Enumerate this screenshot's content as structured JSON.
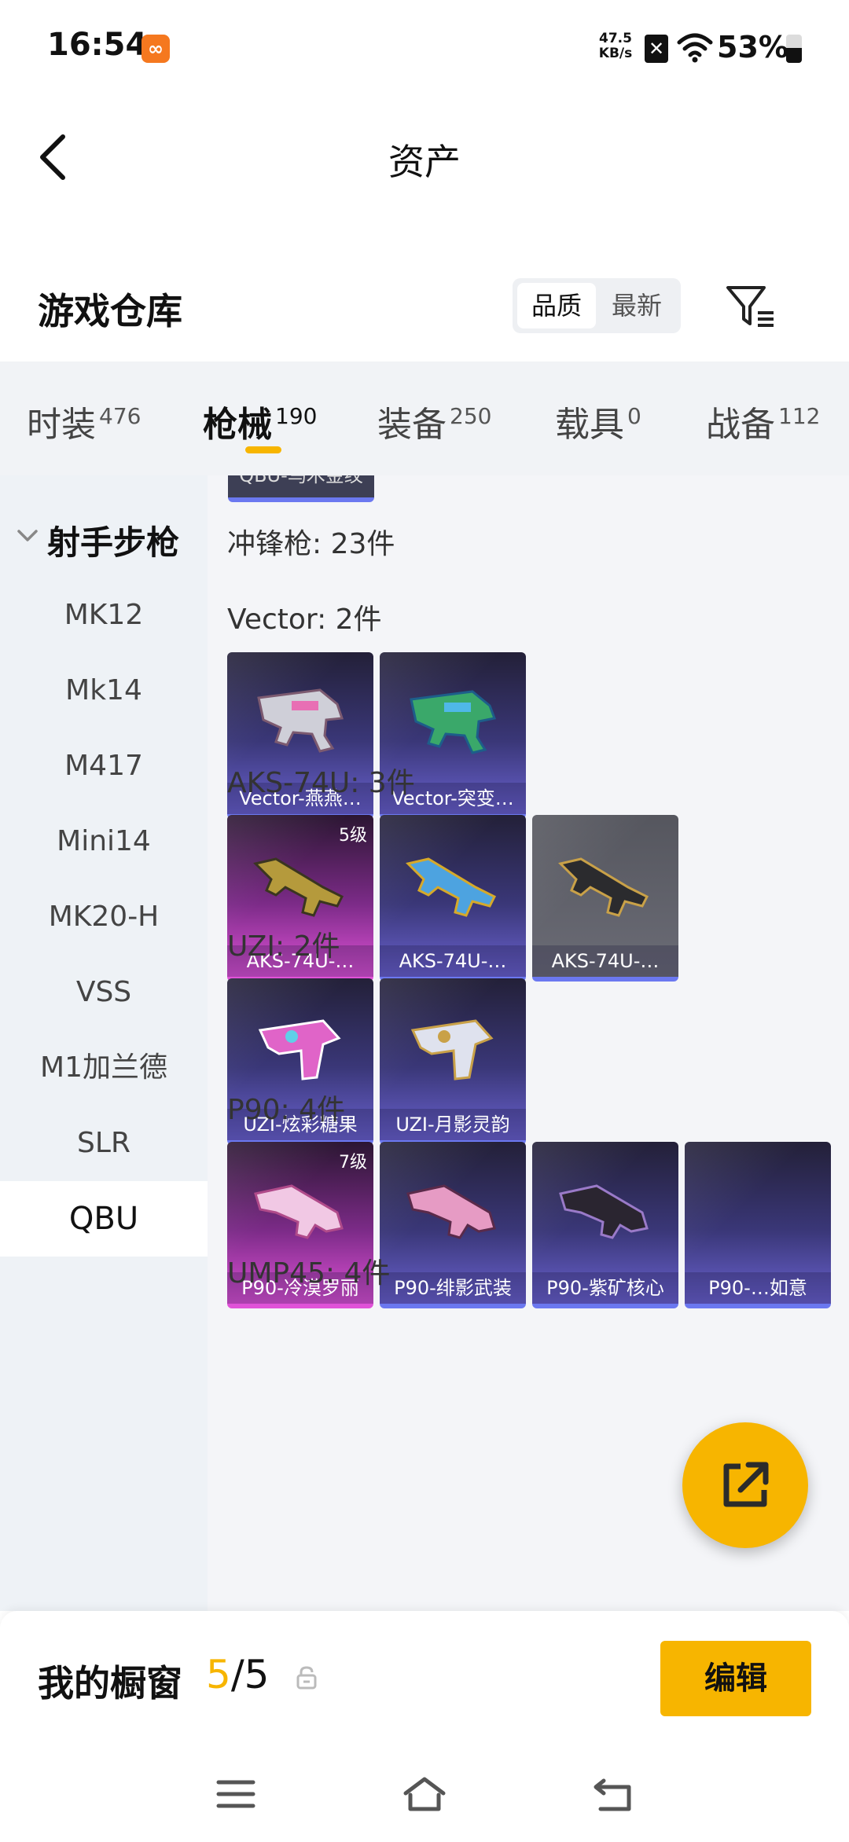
{
  "status_bar": {
    "time": "16:54",
    "app_icon": "orange-app-icon",
    "net_speed_value": "47.5",
    "net_speed_unit": "KB/s",
    "battery": "53%",
    "battery_level": 0.53
  },
  "header": {
    "title": "资产",
    "back_icon": "back-arrow-icon"
  },
  "warehouse": {
    "title": "游戏仓库",
    "sort_options": [
      "品质",
      "最新"
    ],
    "sort_selected": "品质",
    "filter_icon": "filter-icon"
  },
  "tabs": [
    {
      "label": "时装",
      "count": "476"
    },
    {
      "label": "枪械",
      "count": "190"
    },
    {
      "label": "装备",
      "count": "250"
    },
    {
      "label": "载具",
      "count": "0"
    },
    {
      "label": "战备",
      "count": "112"
    }
  ],
  "active_tab": "枪械",
  "sidebar": {
    "group": "射手步枪",
    "items": [
      "MK12",
      "Mk14",
      "M417",
      "Mini14",
      "MK20-H",
      "VSS",
      "M1加兰德",
      "SLR",
      "QBU"
    ],
    "selected": "QBU"
  },
  "content": {
    "top_cut_label": "QBU-乌木金纹",
    "category_title": "冲锋枪: 23件",
    "groups": [
      {
        "title": "Vector: 2件",
        "items": [
          {
            "name": "Vector-燕燕…",
            "style": "purple",
            "level": ""
          },
          {
            "name": "Vector-突变…",
            "style": "purple",
            "level": ""
          }
        ]
      },
      {
        "title": "AKS-74U: 3件",
        "items": [
          {
            "name": "AKS-74U-…",
            "style": "pink",
            "level": "5级"
          },
          {
            "name": "AKS-74U-…",
            "style": "purple",
            "level": ""
          },
          {
            "name": "AKS-74U-…",
            "style": "gray",
            "level": ""
          }
        ]
      },
      {
        "title": "UZI: 2件",
        "items": [
          {
            "name": "UZI-炫彩糖果",
            "style": "purple",
            "level": ""
          },
          {
            "name": "UZI-月影灵韵",
            "style": "purple",
            "level": ""
          }
        ]
      },
      {
        "title": "P90: 4件",
        "items": [
          {
            "name": "P90-冷漠罗丽",
            "style": "pink",
            "level": "7级"
          },
          {
            "name": "P90-绯影武装",
            "style": "purple",
            "level": ""
          },
          {
            "name": "P90-紫矿核心",
            "style": "purple",
            "level": ""
          },
          {
            "name": "P90-…如意",
            "style": "purple",
            "level": ""
          }
        ]
      },
      {
        "title": "UMP45: 4件",
        "items": []
      }
    ]
  },
  "fab": {
    "icon": "share-external-icon"
  },
  "showcase": {
    "label": "我的橱窗",
    "current": "5",
    "total": "/5",
    "lock_icon": "lock-icon",
    "edit_label": "编辑"
  },
  "system_nav": {
    "icons": [
      "menu-icon",
      "home-icon",
      "back-icon"
    ]
  },
  "colors": {
    "accent": "#f7b500",
    "card_purple": "#3a3778",
    "card_pink": "#c03cc0",
    "card_border": "#6b78f0"
  }
}
